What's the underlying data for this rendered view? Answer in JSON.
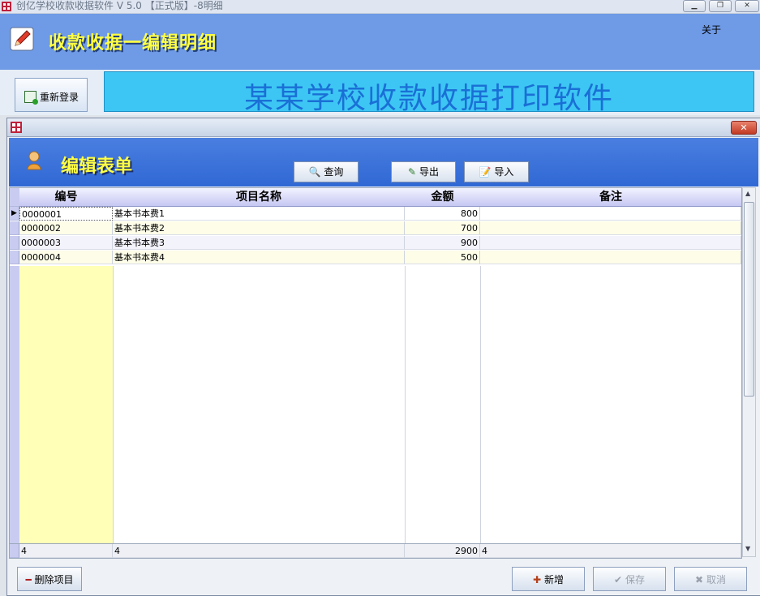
{
  "window": {
    "title": "创亿学校收款收据软件 V 5.0 【正式版】-8明细"
  },
  "header": {
    "caption": "收款收据一编辑明细",
    "about_label": "关于"
  },
  "toolbar_top": {
    "relogin_label": "重新登录",
    "banner": "某某学校收款收据打印软件"
  },
  "dialog": {
    "heading": "编辑表单",
    "query_label": "查询",
    "export_label": "导出",
    "import_label": "导入",
    "close_glyph": "✕"
  },
  "grid": {
    "columns": [
      "编号",
      "项目名称",
      "金额",
      "备注"
    ],
    "rows": [
      {
        "id": "0000001",
        "name": "基本书本费1",
        "amount": "800",
        "note": ""
      },
      {
        "id": "0000002",
        "name": "基本书本费2",
        "amount": "700",
        "note": ""
      },
      {
        "id": "0000003",
        "name": "基本书本费3",
        "amount": "900",
        "note": ""
      },
      {
        "id": "0000004",
        "name": "基本书本费4",
        "amount": "500",
        "note": ""
      }
    ],
    "summary": {
      "id": "4",
      "name": "4",
      "amount": "2900",
      "note": "4"
    }
  },
  "footer": {
    "delete_label": "删除项目",
    "add_label": "新增",
    "save_label": "保存",
    "cancel_label": "取消"
  },
  "colors": {
    "header_bg": "#6e9ae6",
    "banner_bg": "#3dc6f3",
    "caption_text": "#ffff44",
    "toolband_bg": "#3a72d8",
    "first_col_bg": "#ffffb8"
  }
}
